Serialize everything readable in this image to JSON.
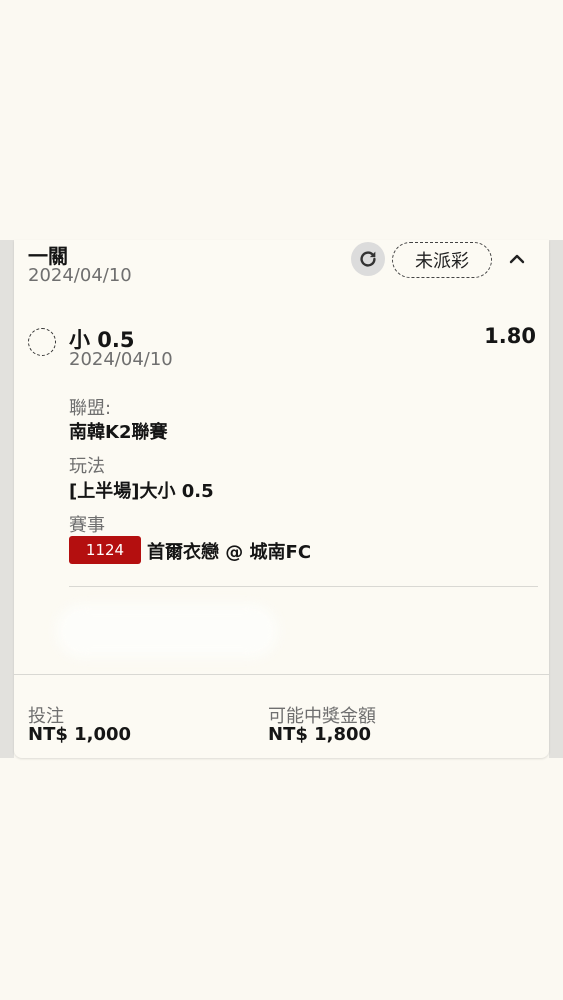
{
  "bet": {
    "type": "一關",
    "date": "2024/04/10",
    "status": "未派彩",
    "refresh_icon": "refresh-icon",
    "collapse_icon": "chevron-up-icon"
  },
  "selection": {
    "name": "小 0.5",
    "date": "2024/04/10",
    "odds": "1.80",
    "league_label": "聯盟:",
    "league_value": "南韓K2聯賽",
    "market_label": "玩法",
    "market_value": "[上半場]大小 0.5",
    "event_label": "賽事",
    "event_code": "1124",
    "event_name": "首爾衣戀 @ 城南FC"
  },
  "footer": {
    "stake_label": "投注",
    "stake_value": "NT$ 1,000",
    "payout_label": "可能中獎金額",
    "payout_value": "NT$ 1,800"
  },
  "colors": {
    "background": "#fbf9f2",
    "event_code_bg": "#b40f0f",
    "muted_text": "#6f6f6f"
  }
}
